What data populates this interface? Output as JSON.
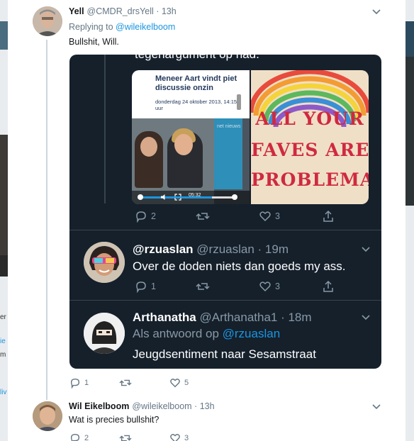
{
  "colors": {
    "accent": "#1b95e0",
    "dark_card": "#15202b",
    "text_dark": "#14171a",
    "muted": "#657786"
  },
  "main_tweet": {
    "name": "Yell",
    "handle": "@CMDR_drsYell",
    "time": "13h",
    "replying_label": "Replying to",
    "replying_to": "@wileikelboom",
    "text": "Bullshit, Will.",
    "actions": {
      "replies": "1",
      "retweets": "",
      "likes": "5"
    }
  },
  "embedded": {
    "cut_text": "tegenargument op had.",
    "media1": {
      "title": "Meneer Aart vindt piet discussie onzin",
      "date": "donderdag 24 oktober 2013, 14:15 uur",
      "video_time": "05:32",
      "badge": "net nieuws"
    },
    "media2": {
      "lines": [
        "ALL YOUR",
        "FAVES ARE",
        "PROBLEMAT"
      ]
    },
    "actions": {
      "replies": "2",
      "retweets": "",
      "likes": "3"
    },
    "reply1": {
      "name": "@rzuaslan",
      "handle": "@rzuaslan",
      "time": "19m",
      "text": "Over de doden niets dan goeds my ass.",
      "actions": {
        "replies": "1",
        "retweets": "",
        "likes": "3"
      }
    },
    "reply2": {
      "name": "Arthanatha",
      "handle": "@Arthanatha1",
      "time": "18m",
      "replying_label": "Als antwoord op",
      "replying_to": "@rzuaslan",
      "text": "Jeugdsentiment naar Sesamstraat"
    }
  },
  "second_tweet": {
    "name": "Wil Eikelboom",
    "handle": "@wileikelboom",
    "time": "13h",
    "text": "Wat is precies bullshit?",
    "actions": {
      "replies": "2",
      "retweets": "",
      "likes": "3"
    }
  },
  "background_fragments": [
    "er",
    "ie",
    "m",
    "liv"
  ]
}
